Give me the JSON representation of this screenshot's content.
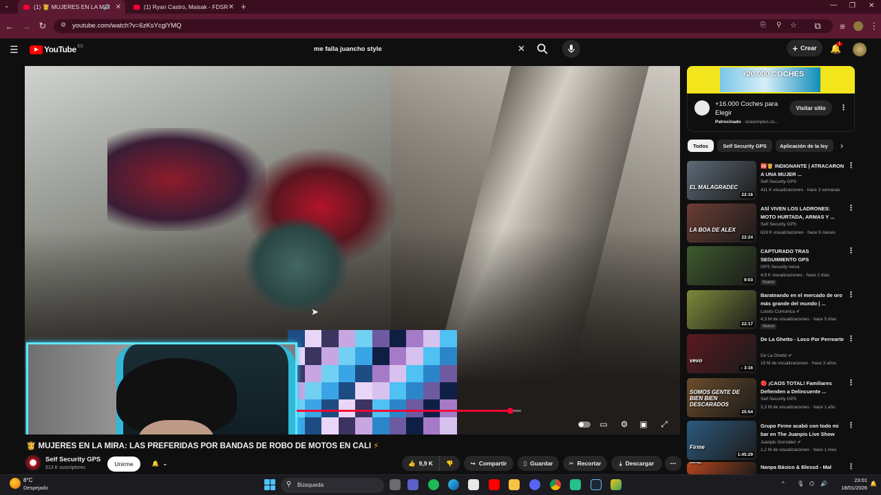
{
  "browser": {
    "tabs": [
      {
        "title": "(1) 👸 MUJERES EN LA MIR",
        "active": true
      },
      {
        "title": "(1) Ryan Castro, Maisak - FDSR",
        "active": false
      }
    ],
    "url": "youtube.com/watch?v=6zKsYcglYMQ",
    "accent_color": "#5b1a31"
  },
  "youtube": {
    "logo_text": "YouTube",
    "region": "ES",
    "search_query": "me falla juancho style",
    "create_label": "Crear",
    "notification_count": "1"
  },
  "player": {
    "progress": 0.95,
    "controls": [
      "autoplay-toggle",
      "subtitles-icon",
      "settings-icon",
      "miniplayer-icon",
      "fullscreen-icon"
    ]
  },
  "video": {
    "title": "MUJERES EN LA MIRA: LAS PREFERIDAS POR BANDAS DE ROBO DE MOTOS EN CALI",
    "title_prefix": "👸",
    "title_suffix": "⚡",
    "channel": "Self Security GPS",
    "subscribers": "513 K suscriptores",
    "join_label": "Unirme",
    "likes": "9,9 K",
    "share_label": "Compartir",
    "save_label": "Guardar",
    "clip_label": "Recortar",
    "download_label": "Descargar"
  },
  "ad": {
    "banner_text": "+20.000 COCHES",
    "title": "+16.000 Coches para Elegir",
    "sponsored": "Patrocinado",
    "domain": "ocasionplus.co...",
    "button": "Visitar sitio"
  },
  "chips": [
    "Todos",
    "Self Security GPS",
    "Aplicación de la ley"
  ],
  "recommendations": [
    {
      "title": "🆘👸 INDIGNANTE | ATRACARON A UNA MUJER ...",
      "channel": "Self Security GPS",
      "meta": "411 K visualizaciones · hace 3 semanas",
      "duration": "22:16",
      "badge": "",
      "thumb_text": "EL MALAGRADEC",
      "color": "#5d6a77"
    },
    {
      "title": "ASÍ VIVEN LOS LADRONES: MOTO HURTADA, ARMAS Y ...",
      "channel": "Self Security GPS",
      "meta": "619 K visualizaciones · hace 5 meses",
      "duration": "22:24",
      "badge": "",
      "thumb_text": "LA BOA DE ALEX",
      "color": "#6c3d35"
    },
    {
      "title": "CAPTURADO TRAS SEGUIMIENTO GPS",
      "channel": "GPS Security neiva",
      "meta": "4,9 K visualizaciones · hace 2 días",
      "duration": "9:03",
      "badge": "Nuevo",
      "thumb_text": "",
      "color": "#3d5a2c"
    },
    {
      "title": "Barateando en el mercado de oro más grande del mundo | ...",
      "channel": "Luisito Comunica ✔",
      "meta": "4,3 M de visualizaciones · hace 5 días",
      "duration": "22:17",
      "badge": "Nuevo",
      "thumb_text": "",
      "color": "#7e8a3a"
    },
    {
      "title": "De La Ghetto - Loco Por Perrearte",
      "channel": "De La Ghetto ✔",
      "meta": "15 M de visualizaciones · hace 3 años",
      "duration": "♪ 3:16",
      "badge": "",
      "thumb_text": "vevo",
      "color": "#5a1a20"
    },
    {
      "title": "🔴 ¡CAOS TOTAL! Familiares Defienden a Delincuente ...",
      "channel": "Self Security GPS",
      "meta": "3,3 M de visualizaciones · hace 1 año",
      "duration": "25:54",
      "badge": "",
      "thumb_text": "SOMOS GENTE DE BIEN BIEN DESCARADOS",
      "color": "#6b4c2a"
    },
    {
      "title": "Grupo Firme acabó con todo mi bar en The Juanpis Live Show",
      "channel": "Juanpis González ✔",
      "meta": "1,2 M de visualizaciones · hace 1 mes",
      "duration": "1:45:29",
      "badge": "",
      "thumb_text": "Firme",
      "color": "#2c5a7e"
    },
    {
      "title": "Nanpa Básico & Blessd - Mal",
      "channel": "",
      "meta": "",
      "duration": "",
      "badge": "",
      "thumb_text": "MAL",
      "color": "#b8471c"
    }
  ],
  "taskbar": {
    "temperature": "8°C",
    "weather": "Despejado",
    "search_label": "Búsqueda",
    "time": "23:01",
    "date": "18/01/2026"
  }
}
